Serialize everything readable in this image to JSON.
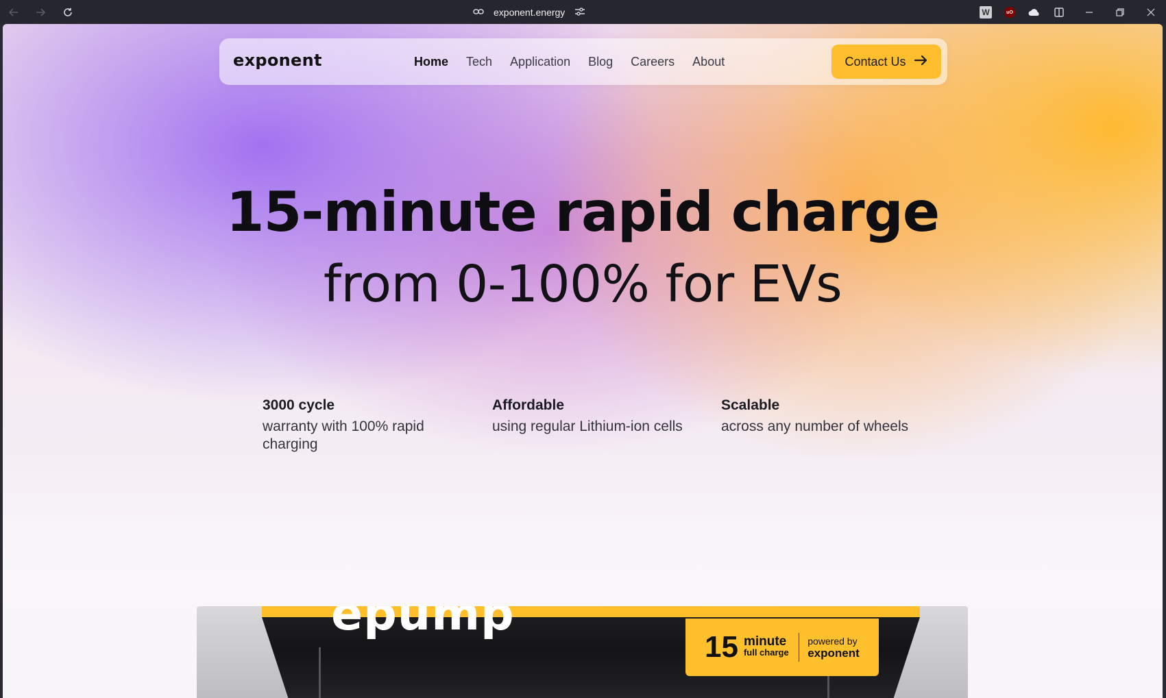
{
  "browser": {
    "url": "exponent.energy",
    "extensions": [
      "w-extension-icon",
      "ublock-icon",
      "cloud-icon",
      "sidebar-icon"
    ],
    "ublock_label": "uO",
    "w_label": "W"
  },
  "site": {
    "logo": "exponent",
    "nav": {
      "items": [
        "Home",
        "Tech",
        "Application",
        "Blog",
        "Careers",
        "About"
      ],
      "active": "Home"
    },
    "contact_label": "Contact Us",
    "colors": {
      "accent": "#ffbe2e",
      "text": "#0d0d12"
    }
  },
  "hero": {
    "line1": "15-minute rapid charge",
    "line2": "from 0-100% for EVs"
  },
  "features": [
    {
      "title": "3000 cycle",
      "desc": "warranty with 100% rapid charging"
    },
    {
      "title": "Affordable",
      "desc": "using regular Lithium-ion cells"
    },
    {
      "title": "Scalable",
      "desc": "across any number of wheels"
    }
  ],
  "banner": {
    "brand": "epump",
    "badge_number": "15",
    "badge_unit": "minute",
    "badge_sub": "full charge",
    "powered_label": "powered by",
    "powered_brand": "exponent"
  }
}
